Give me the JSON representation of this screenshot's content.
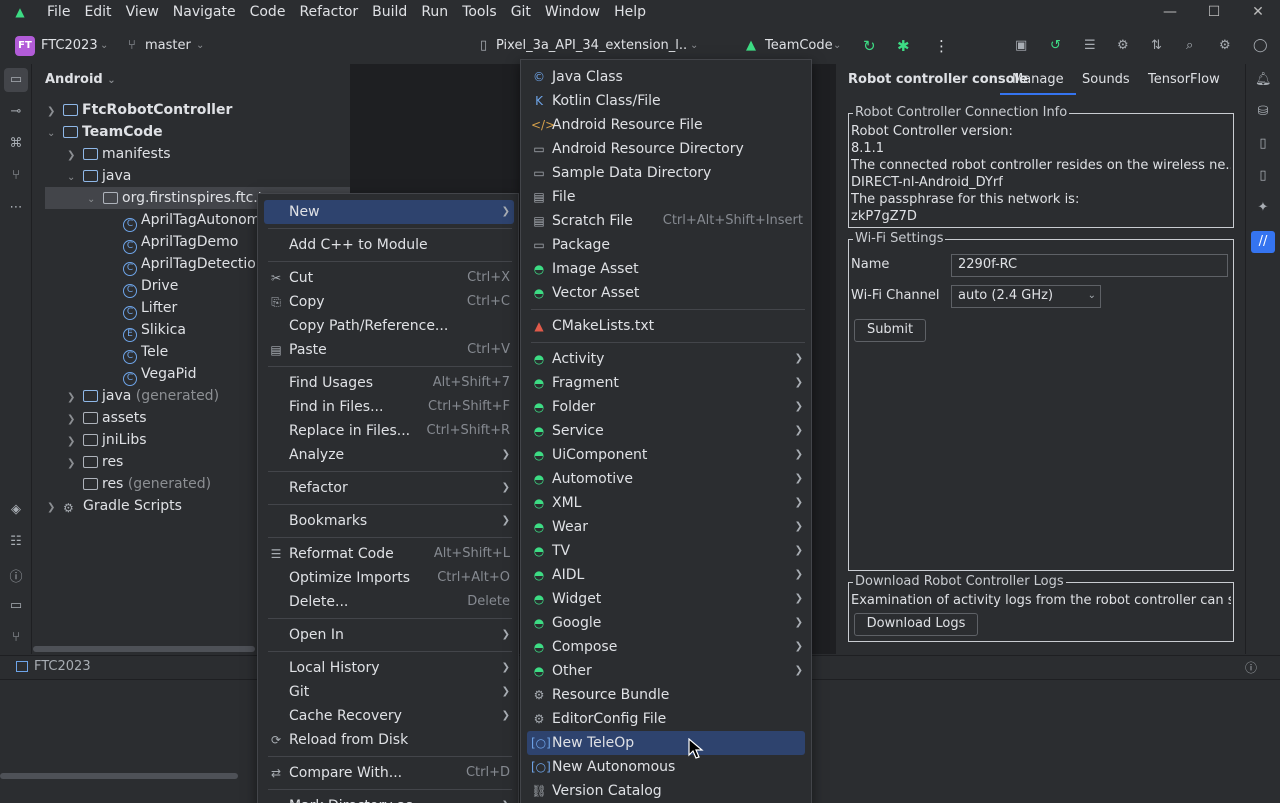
{
  "menubar": {
    "items": [
      "File",
      "Edit",
      "View",
      "Navigate",
      "Code",
      "Refactor",
      "Build",
      "Run",
      "Tools",
      "Git",
      "Window",
      "Help"
    ]
  },
  "toolbar": {
    "project_badge": "FT",
    "project_name": "FTC2023",
    "branch": "master",
    "device": "Pixel_3a_API_34_extension_l...",
    "run_config": "TeamCode"
  },
  "project_panel": {
    "view": "Android",
    "rows": [
      {
        "label": "FtcRobotController",
        "bold": true
      },
      {
        "label": "TeamCode",
        "bold": true
      },
      {
        "label": "manifests"
      },
      {
        "label": "java"
      },
      {
        "label": "org.firstinspires.ftc.te"
      },
      {
        "label": "AprilTagAutonomo"
      },
      {
        "label": "AprilTagDemo"
      },
      {
        "label": "AprilTagDetection"
      },
      {
        "label": "Drive"
      },
      {
        "label": "Lifter"
      },
      {
        "label": "Slikica"
      },
      {
        "label": "Tele"
      },
      {
        "label": "VegaPid"
      },
      {
        "label": "java",
        "suffix": "(generated)"
      },
      {
        "label": "assets"
      },
      {
        "label": "jniLibs"
      },
      {
        "label": "res"
      },
      {
        "label": "res",
        "suffix": "(generated)"
      },
      {
        "label": "Gradle Scripts"
      }
    ]
  },
  "console": {
    "title": "Robot controller console",
    "tabs": [
      "Manage",
      "Sounds",
      "TensorFlow"
    ],
    "connection": {
      "legend": "Robot Controller Connection Info",
      "lines": [
        "Robot Controller version:",
        "8.1.1",
        "The connected robot controller resides on the wireless ne...",
        "DIRECT-nl-Android_DYrf",
        "The passphrase for this network is:",
        "zkP7gZ7D"
      ]
    },
    "wifi": {
      "legend": "Wi-Fi Settings",
      "name_label": "Name",
      "name_value": "2290f-RC",
      "channel_label": "Wi-Fi Channel",
      "channel_value": "auto (2.4 GHz)",
      "submit": "Submit"
    },
    "logs": {
      "legend": "Download Robot Controller Logs",
      "text": "Examination of activity logs from the robot controller can s...",
      "button": "Download Logs"
    }
  },
  "run_bar": {
    "label": "FTC2023"
  },
  "context_menu": {
    "items": [
      {
        "label": "New",
        "submenu": true,
        "highlight": true
      },
      {
        "label": "Add C++ to Module"
      },
      {
        "label": "Cut",
        "shortcut": "Ctrl+X",
        "icon": "✂"
      },
      {
        "label": "Copy",
        "shortcut": "Ctrl+C",
        "icon": "⎘"
      },
      {
        "label": "Copy Path/Reference..."
      },
      {
        "label": "Paste",
        "shortcut": "Ctrl+V",
        "icon": "📋"
      },
      {
        "label": "Find Usages",
        "shortcut": "Alt+Shift+7"
      },
      {
        "label": "Find in Files...",
        "shortcut": "Ctrl+Shift+F"
      },
      {
        "label": "Replace in Files...",
        "shortcut": "Ctrl+Shift+R"
      },
      {
        "label": "Analyze",
        "submenu": true
      },
      {
        "label": "Refactor",
        "submenu": true
      },
      {
        "label": "Bookmarks",
        "submenu": true
      },
      {
        "label": "Reformat Code",
        "shortcut": "Alt+Shift+L",
        "icon": "☰"
      },
      {
        "label": "Optimize Imports",
        "shortcut": "Ctrl+Alt+O"
      },
      {
        "label": "Delete...",
        "shortcut": "Delete"
      },
      {
        "label": "Open In",
        "submenu": true
      },
      {
        "label": "Local History",
        "submenu": true
      },
      {
        "label": "Git",
        "submenu": true
      },
      {
        "label": "Cache Recovery",
        "submenu": true
      },
      {
        "label": "Reload from Disk",
        "icon": "⟳"
      },
      {
        "label": "Compare With...",
        "shortcut": "Ctrl+D",
        "icon": "⇄"
      },
      {
        "label": "Mark Directory as",
        "submenu": true
      }
    ]
  },
  "new_submenu": {
    "items": [
      {
        "label": "Java Class",
        "icon": "©"
      },
      {
        "label": "Kotlin Class/File",
        "icon": "K"
      },
      {
        "label": "Android Resource File",
        "icon": "</>"
      },
      {
        "label": "Android Resource Directory",
        "icon": "▭"
      },
      {
        "label": "Sample Data Directory",
        "icon": "▭"
      },
      {
        "label": "File",
        "icon": "▤"
      },
      {
        "label": "Scratch File",
        "shortcut": "Ctrl+Alt+Shift+Insert",
        "icon": "▤"
      },
      {
        "label": "Package",
        "icon": "▭"
      },
      {
        "label": "Image Asset",
        "icon": "◓"
      },
      {
        "label": "Vector Asset",
        "icon": "◓"
      },
      {
        "label": "CMakeLists.txt",
        "icon": "▲"
      },
      {
        "label": "Activity",
        "submenu": true,
        "icon": "◓"
      },
      {
        "label": "Fragment",
        "submenu": true,
        "icon": "◓"
      },
      {
        "label": "Folder",
        "submenu": true,
        "icon": "◓"
      },
      {
        "label": "Service",
        "submenu": true,
        "icon": "◓"
      },
      {
        "label": "UiComponent",
        "submenu": true,
        "icon": "◓"
      },
      {
        "label": "Automotive",
        "submenu": true,
        "icon": "◓"
      },
      {
        "label": "XML",
        "submenu": true,
        "icon": "◓"
      },
      {
        "label": "Wear",
        "submenu": true,
        "icon": "◓"
      },
      {
        "label": "TV",
        "submenu": true,
        "icon": "◓"
      },
      {
        "label": "AIDL",
        "submenu": true,
        "icon": "◓"
      },
      {
        "label": "Widget",
        "submenu": true,
        "icon": "◓"
      },
      {
        "label": "Google",
        "submenu": true,
        "icon": "◓"
      },
      {
        "label": "Compose",
        "submenu": true,
        "icon": "◓"
      },
      {
        "label": "Other",
        "submenu": true,
        "icon": "◓"
      },
      {
        "label": "Resource Bundle",
        "icon": "⚙"
      },
      {
        "label": "EditorConfig File",
        "icon": "⚙"
      },
      {
        "label": "New TeleOp",
        "icon": "[○]",
        "highlight": true
      },
      {
        "label": "New Autonomous",
        "icon": "[○]"
      },
      {
        "label": "Version Catalog",
        "icon": "⛓"
      }
    ]
  }
}
